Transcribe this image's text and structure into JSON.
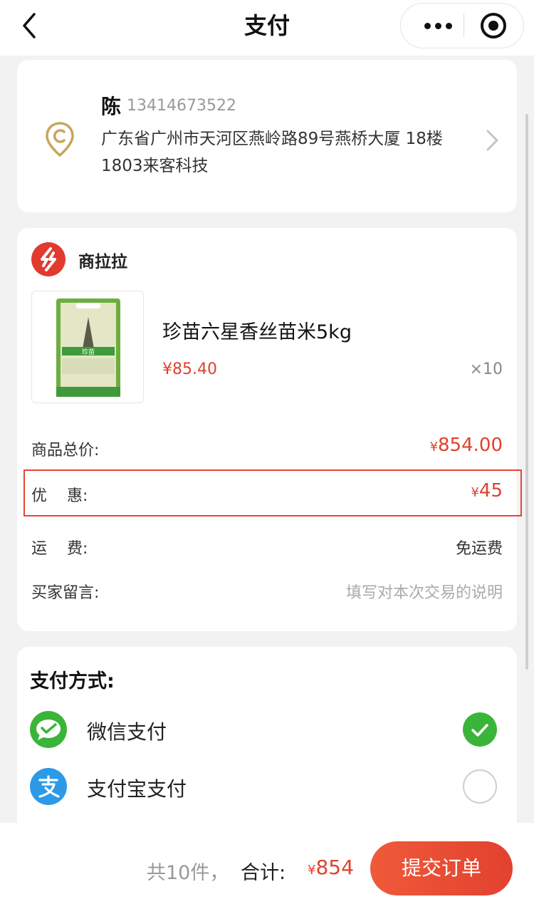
{
  "header": {
    "title": "支付"
  },
  "address": {
    "name": "陈",
    "phone": "13414673522",
    "text": "广东省广州市天河区燕岭路89号燕桥大厦 18楼1803来客科技"
  },
  "shop": {
    "name": "商拉拉",
    "brand_color": "#e13a2f",
    "product": {
      "name": "珍苗六星香丝苗米5kg",
      "price": "¥85.40",
      "quantity": "×10",
      "package_text": "珍苗"
    },
    "summary": {
      "total_label": "商品总价:",
      "total_currency": "¥",
      "total_value": "854.00",
      "discount_label": "优    惠:",
      "discount_currency": "¥",
      "discount_value": "45",
      "shipping_label": "运    费:",
      "shipping_value": "免运费",
      "note_label": "买家留言:",
      "note_placeholder": "填写对本次交易的说明"
    }
  },
  "payment": {
    "title": "支付方式:",
    "methods": [
      {
        "label": "微信支付",
        "icon": "wechat-pay-icon",
        "color": "#3bb43a",
        "selected": true
      },
      {
        "label": "支付宝支付",
        "icon": "alipay-icon",
        "color": "#2d9ae8",
        "selected": false
      }
    ]
  },
  "footer": {
    "count": "共10件，",
    "total_label": "合计:",
    "currency": "¥",
    "total_value": "854",
    "submit_label": "提交订单"
  }
}
